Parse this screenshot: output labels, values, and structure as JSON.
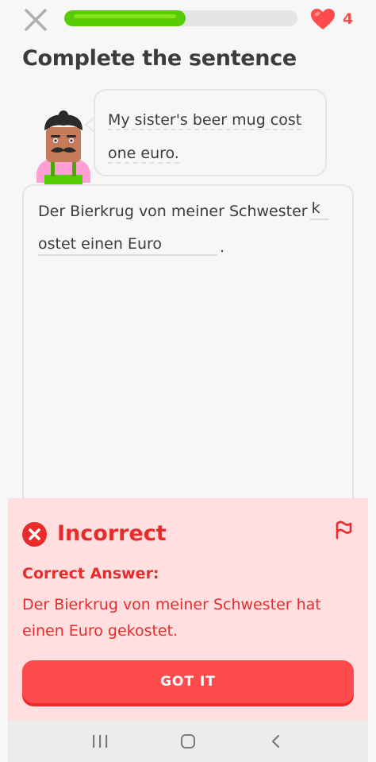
{
  "header": {
    "progress": 0.52,
    "hearts": "4",
    "close_icon": "close-icon",
    "heart_icon": "heart-icon"
  },
  "title": "Complete the sentence",
  "prompt": {
    "line1": "My sister's beer mug cost",
    "line2": "one euro."
  },
  "answer": {
    "line1": "Der Bierkrug von meiner Schwester",
    "blank1_letter": "k",
    "line2": "ostet einen Euro",
    "period": "."
  },
  "feedback": {
    "status": "Incorrect",
    "correct_label": "Correct Answer:",
    "correct_answer": "Der Bierkrug von meiner Schwester hat einen Euro gekostet.",
    "button": "GOT IT",
    "colors": {
      "background": "#ffdfe0",
      "accent": "#ea2b2b",
      "button": "#ff4b4b"
    }
  },
  "nav": {
    "recents_icon": "recents-icon",
    "home_icon": "home-icon",
    "back_icon": "back-icon"
  }
}
